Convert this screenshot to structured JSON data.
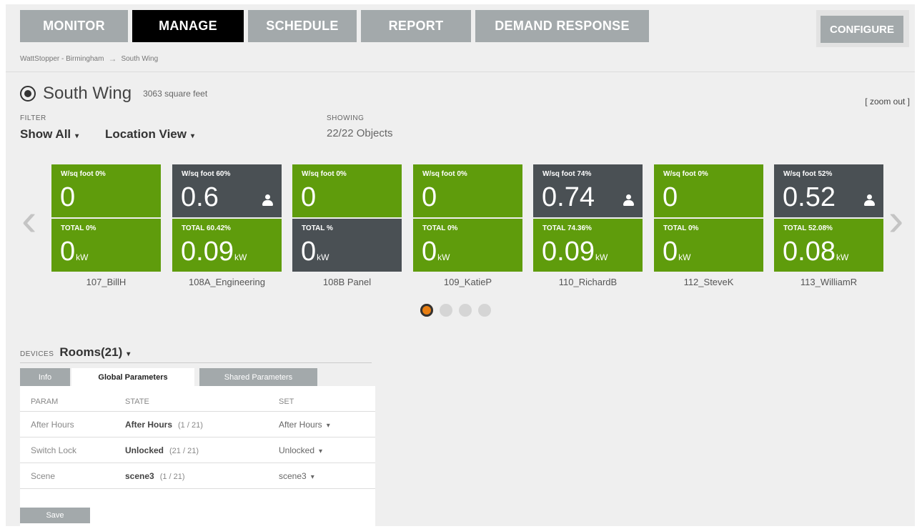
{
  "nav": {
    "tabs": [
      {
        "label": "MONITOR",
        "active": false
      },
      {
        "label": "MANAGE",
        "active": true
      },
      {
        "label": "SCHEDULE",
        "active": false
      },
      {
        "label": "REPORT",
        "active": false
      },
      {
        "label": "DEMAND RESPONSE",
        "active": false
      }
    ],
    "configure_label": "CONFIGURE"
  },
  "breadcrumb": {
    "parent": "WattStopper - Birmingham",
    "current": "South Wing"
  },
  "header": {
    "title": "South Wing",
    "subtitle": "3063 square feet",
    "zoom_out": "[ zoom out ]"
  },
  "filter": {
    "label": "FILTER",
    "show": "Show All",
    "view": "Location View"
  },
  "showing": {
    "label": "SHOWING",
    "value": "22/22 Objects"
  },
  "tiles": [
    {
      "name": "107_BillH",
      "top_caption": "W/sq foot  0%",
      "top_value": "0",
      "bottom_caption": "TOTAL  0%",
      "bottom_value": "0",
      "unit": "kW",
      "top_color": "green",
      "bottom_color": "green",
      "occupied": false
    },
    {
      "name": "108A_Engineering",
      "top_caption": "W/sq foot  60%",
      "top_value": "0.6",
      "bottom_caption": "TOTAL  60.42%",
      "bottom_value": "0.09",
      "unit": "kW",
      "top_color": "gray",
      "bottom_color": "green",
      "occupied": true
    },
    {
      "name": "108B Panel",
      "top_caption": "W/sq foot  0%",
      "top_value": "0",
      "bottom_caption": "TOTAL  %",
      "bottom_value": "0",
      "unit": "kW",
      "top_color": "green",
      "bottom_color": "gray",
      "occupied": false
    },
    {
      "name": "109_KatieP",
      "top_caption": "W/sq foot  0%",
      "top_value": "0",
      "bottom_caption": "TOTAL  0%",
      "bottom_value": "0",
      "unit": "kW",
      "top_color": "green",
      "bottom_color": "green",
      "occupied": false
    },
    {
      "name": "110_RichardB",
      "top_caption": "W/sq foot  74%",
      "top_value": "0.74",
      "bottom_caption": "TOTAL  74.36%",
      "bottom_value": "0.09",
      "unit": "kW",
      "top_color": "gray",
      "bottom_color": "green",
      "occupied": true
    },
    {
      "name": "112_SteveK",
      "top_caption": "W/sq foot  0%",
      "top_value": "0",
      "bottom_caption": "TOTAL  0%",
      "bottom_value": "0",
      "unit": "kW",
      "top_color": "green",
      "bottom_color": "green",
      "occupied": false
    },
    {
      "name": "113_WilliamR",
      "top_caption": "W/sq foot  52%",
      "top_value": "0.52",
      "bottom_caption": "TOTAL  52.08%",
      "bottom_value": "0.08",
      "unit": "kW",
      "top_color": "gray",
      "bottom_color": "green",
      "occupied": true
    }
  ],
  "carousel": {
    "prev": "‹",
    "next": "›",
    "page_count": 4,
    "active_page": 1
  },
  "devices": {
    "label": "DEVICES",
    "select": "Rooms(21)"
  },
  "param_tabs": [
    {
      "label": "Info",
      "active": false
    },
    {
      "label": "Global Parameters",
      "active": true
    },
    {
      "label": "Shared Parameters",
      "active": false
    }
  ],
  "param_table": {
    "headers": [
      "PARAM",
      "STATE",
      "SET"
    ],
    "rows": [
      {
        "param": "After Hours",
        "state": "After Hours",
        "count": "(1 / 21)",
        "set": "After Hours"
      },
      {
        "param": "Switch Lock",
        "state": "Unlocked",
        "count": "(21 / 21)",
        "set": "Unlocked"
      },
      {
        "param": "Scene",
        "state": "scene3",
        "count": "(1 / 21)",
        "set": "scene3"
      }
    ]
  },
  "save_label": "Save",
  "colors": {
    "tile_green": "#5f9c0c",
    "tile_gray": "#4a5054",
    "nav_gray": "#a3a9ab",
    "nav_active": "#000000",
    "dot_active": "#e87e12"
  }
}
